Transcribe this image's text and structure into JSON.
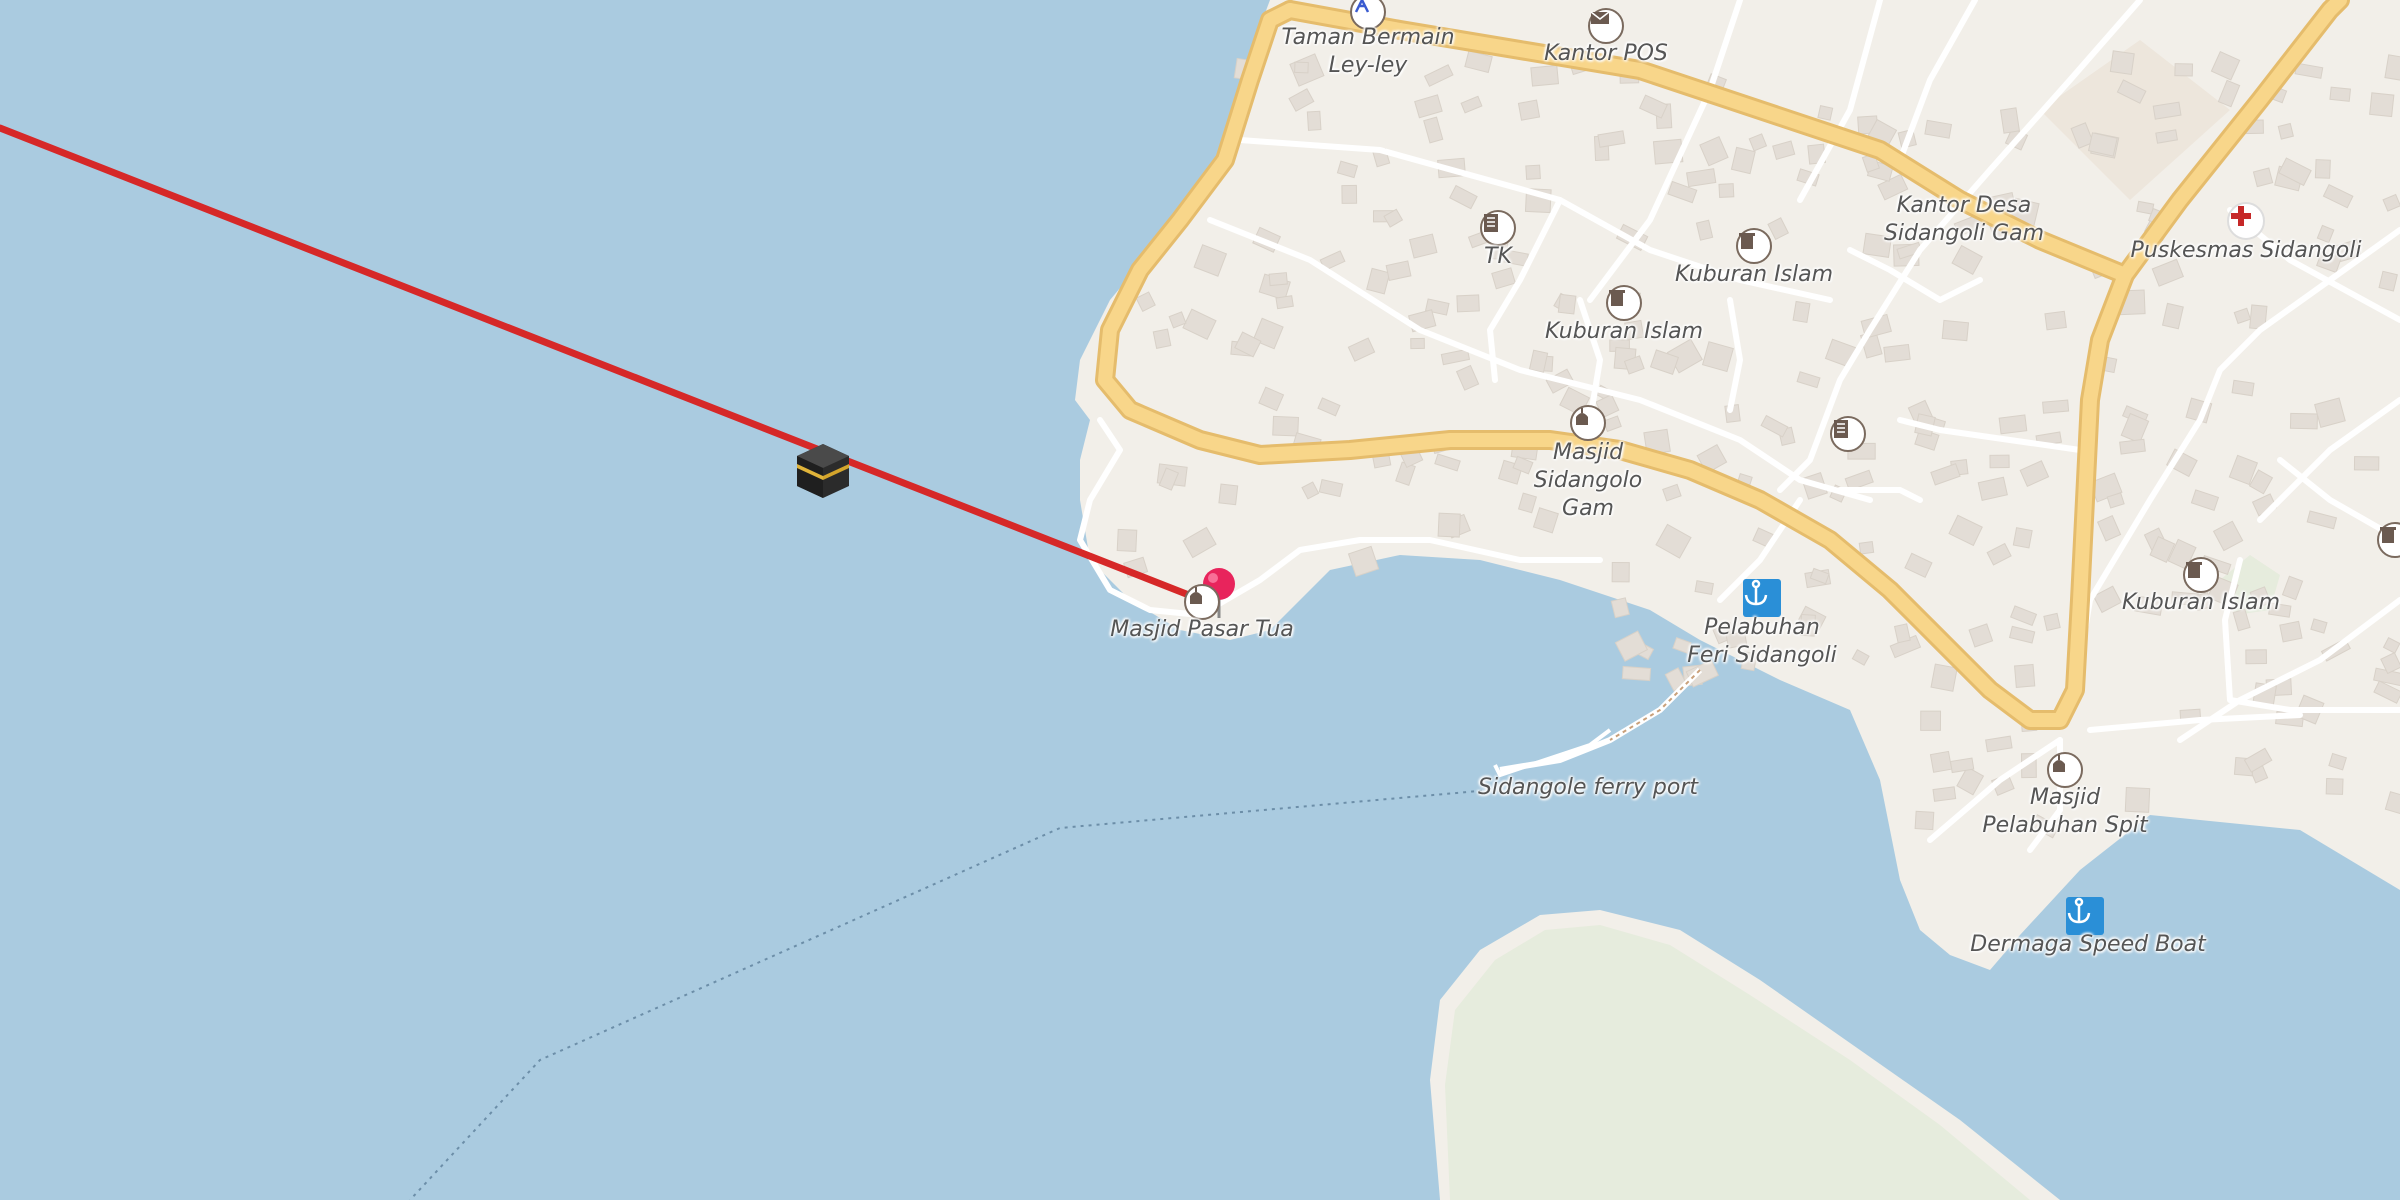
{
  "map": {
    "colors": {
      "water": "#aacbe0",
      "land": "#f2efe9",
      "building": "#e3ddd6",
      "road_major": "#f8d68a",
      "road_casing": "#e8c070",
      "road_minor": "#ffffff",
      "park": "#e6ecdd",
      "qibla_line": "#d62828"
    },
    "labels": {
      "taman_bermain": "Taman Bermain\nLey-ley",
      "kantor_pos": "Kantor POS",
      "kantor_desa": "Kantor Desa\nSidangoli Gam",
      "puskesmas": "Puskesmas Sidangoli",
      "tk": "TK",
      "kuburan_1": "Kuburan Islam",
      "kuburan_2": "Kuburan Islam",
      "kuburan_3": "Kuburan Islam",
      "masjid_gam": "Masjid\nSidangolo\nGam",
      "masjid_pasar": "Masjid Pasar Tua",
      "pelabuhan_feri": "Pelabuhan\nFeri Sidangoli",
      "ferry_port": "Sidangole ferry port",
      "masjid_spit": "Masjid\nPelabuhan Spit",
      "dermaga": "Dermaga Speed Boat"
    },
    "icons": {
      "qibla_marker": "kaaba-icon",
      "location_pin": "map-pin-icon",
      "mosque": "mosque-icon",
      "cemetery": "cemetery-icon",
      "school": "school-icon",
      "post_office": "post-office-icon",
      "hospital": "hospital-cross-icon",
      "ferry": "anchor-icon",
      "playground": "playground-icon"
    }
  }
}
